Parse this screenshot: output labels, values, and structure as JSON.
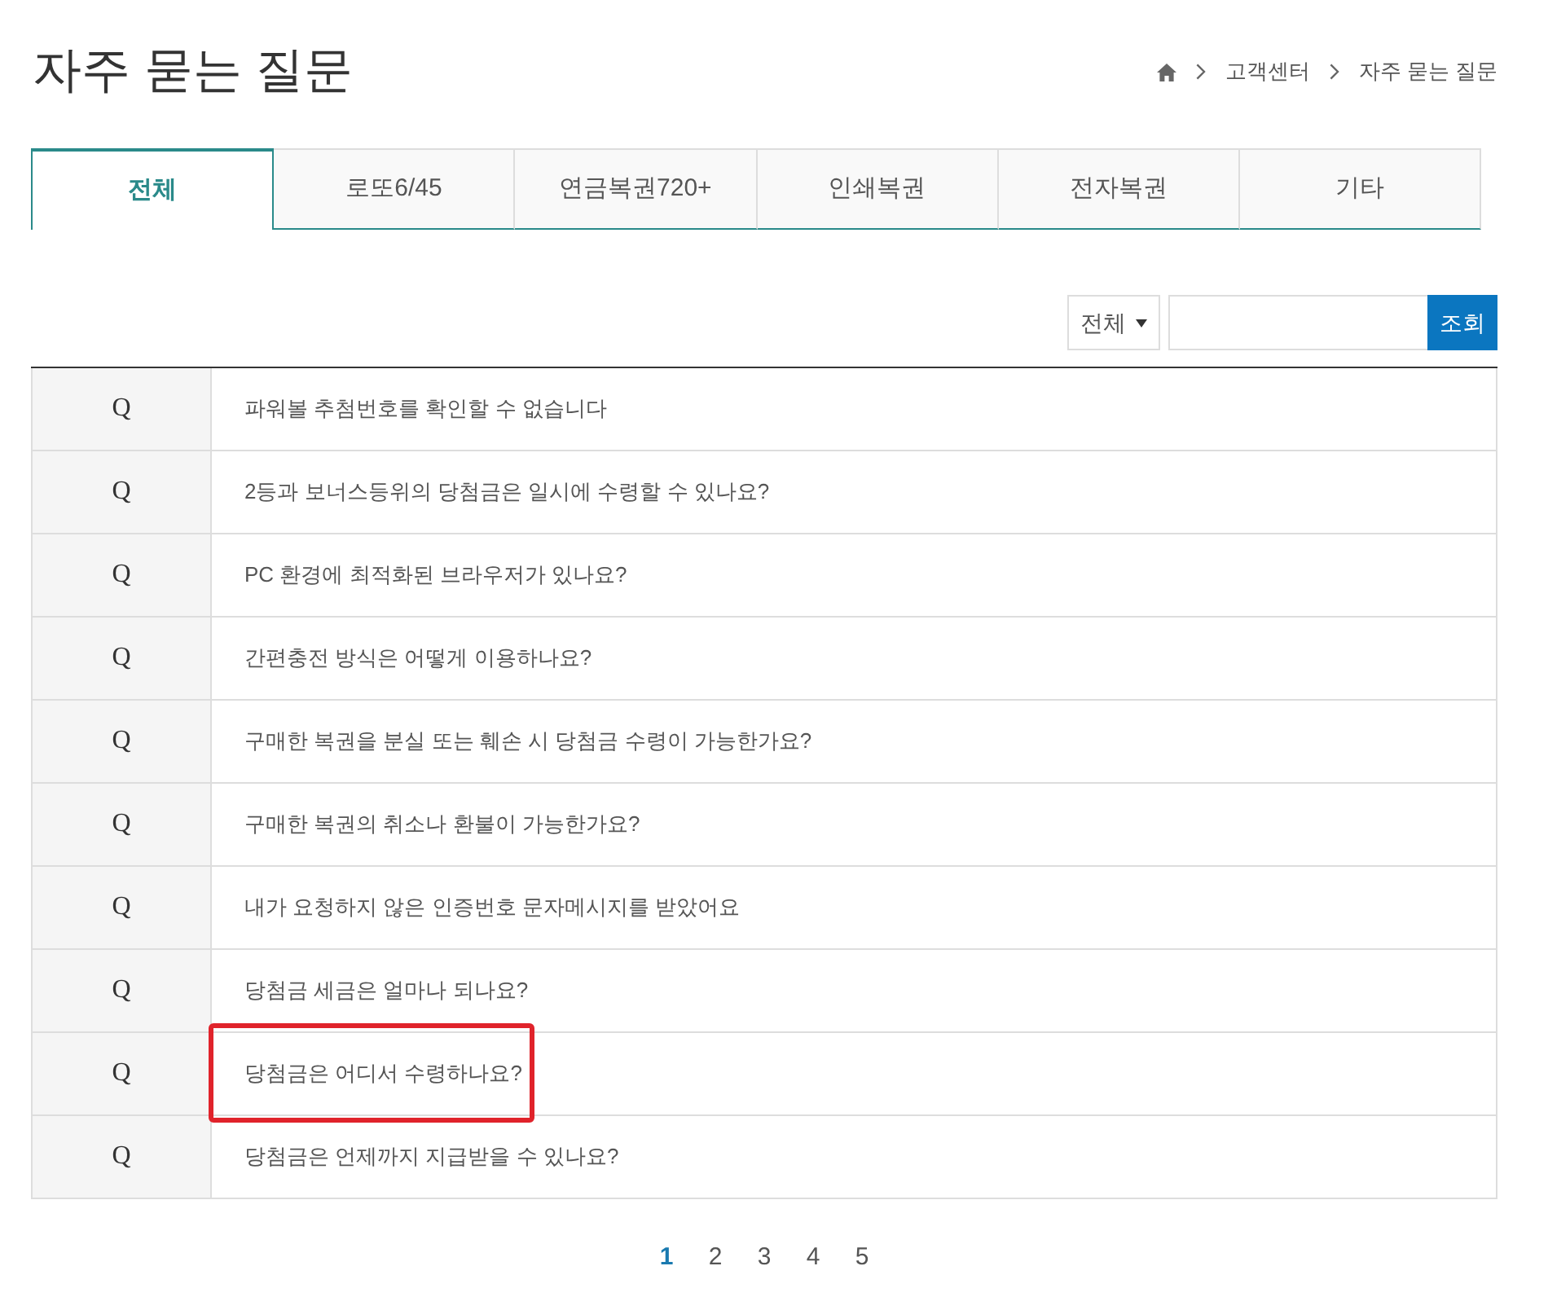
{
  "page": {
    "title": "자주 묻는 질문"
  },
  "breadcrumb": [
    "고객센터",
    "자주 묻는 질문"
  ],
  "tabs": [
    {
      "label": "전체",
      "selected": true
    },
    {
      "label": "로또6/45",
      "selected": false
    },
    {
      "label": "연금복권720+",
      "selected": false
    },
    {
      "label": "인쇄복권",
      "selected": false
    },
    {
      "label": "전자복권",
      "selected": false
    },
    {
      "label": "기타",
      "selected": false
    }
  ],
  "search": {
    "category": "전체",
    "button": "조회"
  },
  "faq": [
    {
      "marker": "Q",
      "question": "파워볼 추첨번호를 확인할 수 없습니다",
      "highlighted": false
    },
    {
      "marker": "Q",
      "question": "2등과 보너스등위의 당첨금은 일시에 수령할 수 있나요?",
      "highlighted": false
    },
    {
      "marker": "Q",
      "question": "PC 환경에 최적화된 브라우저가 있나요?",
      "highlighted": false
    },
    {
      "marker": "Q",
      "question": "간편충전 방식은 어떻게 이용하나요?",
      "highlighted": false
    },
    {
      "marker": "Q",
      "question": "구매한 복권을 분실 또는 훼손 시 당첨금 수령이 가능한가요?",
      "highlighted": false
    },
    {
      "marker": "Q",
      "question": "구매한 복권의 취소나 환불이 가능한가요?",
      "highlighted": false
    },
    {
      "marker": "Q",
      "question": "내가 요청하지 않은 인증번호 문자메시지를 받았어요",
      "highlighted": false
    },
    {
      "marker": "Q",
      "question": "당첨금 세금은 얼마나 되나요?",
      "highlighted": false
    },
    {
      "marker": "Q",
      "question": "당첨금은 어디서 수령하나요?",
      "highlighted": true
    },
    {
      "marker": "Q",
      "question": "당첨금은 언제까지 지급받을 수 있나요?",
      "highlighted": false
    }
  ],
  "pagination": [
    {
      "label": "1",
      "selected": true
    },
    {
      "label": "2",
      "selected": false
    },
    {
      "label": "3",
      "selected": false
    },
    {
      "label": "4",
      "selected": false
    },
    {
      "label": "5",
      "selected": false
    }
  ]
}
